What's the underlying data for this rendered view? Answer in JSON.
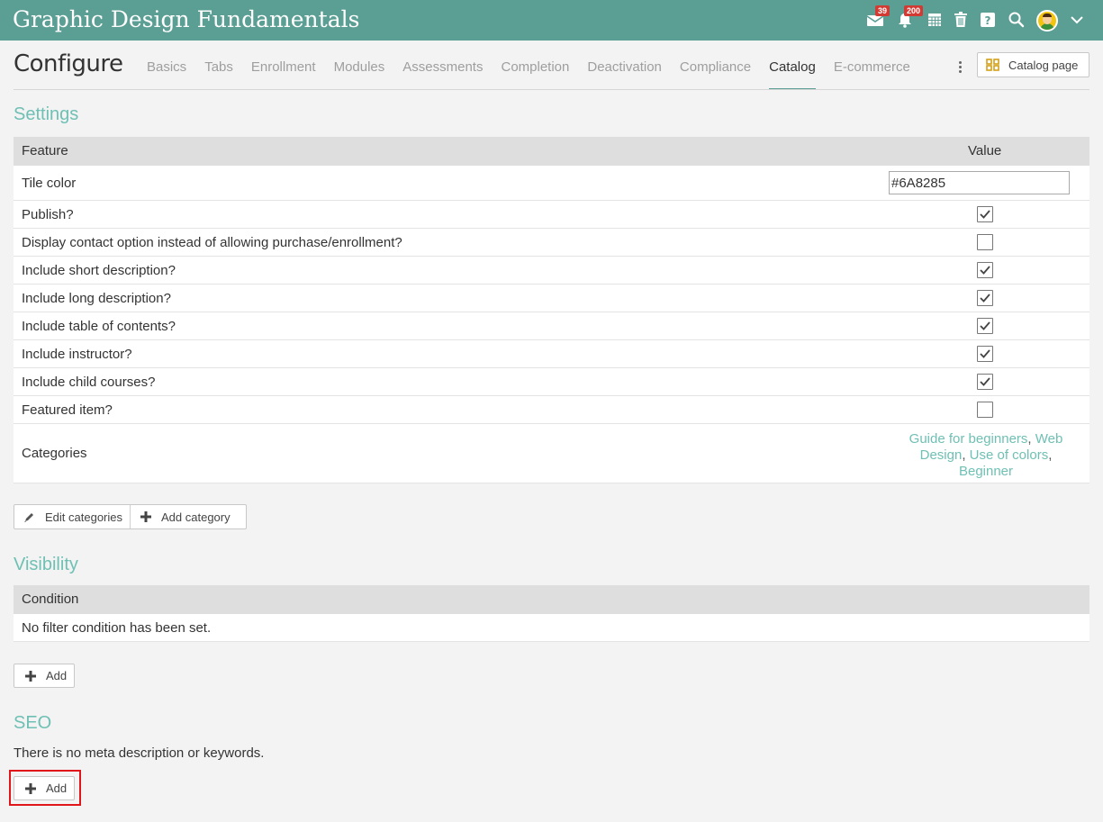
{
  "app": {
    "title": "Graphic Design Fundamentals"
  },
  "topbar": {
    "messages_badge": "39",
    "notifications_badge": "200",
    "icons": [
      "messages-icon",
      "notifications-icon",
      "calendar-icon",
      "trash-icon",
      "help-icon",
      "search-icon",
      "avatar",
      "chevron-down-icon"
    ]
  },
  "page": {
    "title": "Configure"
  },
  "tabs": [
    {
      "label": "Basics",
      "active": false
    },
    {
      "label": "Tabs",
      "active": false
    },
    {
      "label": "Enrollment",
      "active": false
    },
    {
      "label": "Modules",
      "active": false
    },
    {
      "label": "Assessments",
      "active": false
    },
    {
      "label": "Completion",
      "active": false
    },
    {
      "label": "Deactivation",
      "active": false
    },
    {
      "label": "Compliance",
      "active": false
    },
    {
      "label": "Catalog",
      "active": true
    },
    {
      "label": "E-commerce",
      "active": false
    }
  ],
  "catalog_page_button": {
    "label": "Catalog page"
  },
  "settings": {
    "title": "Settings",
    "header": {
      "feature": "Feature",
      "value": "Value"
    },
    "tile_color": {
      "label": "Tile color",
      "value": "#6A8285"
    },
    "rows": [
      {
        "label": "Publish?",
        "checked": true
      },
      {
        "label": "Display contact option instead of allowing purchase/enrollment?",
        "checked": false
      },
      {
        "label": "Include short description?",
        "checked": true
      },
      {
        "label": "Include long description?",
        "checked": true
      },
      {
        "label": "Include table of contents?",
        "checked": true
      },
      {
        "label": "Include instructor?",
        "checked": true
      },
      {
        "label": "Include child courses?",
        "checked": true
      },
      {
        "label": "Featured item?",
        "checked": false
      }
    ],
    "categories": {
      "label": "Categories",
      "items": [
        "Guide for beginners",
        "Web Design",
        "Use of colors",
        "Beginner"
      ]
    },
    "edit_categories": "Edit categories",
    "add_category": "Add category"
  },
  "visibility": {
    "title": "Visibility",
    "header": "Condition",
    "empty": "No filter condition has been set.",
    "add": "Add"
  },
  "seo": {
    "title": "SEO",
    "empty": "There is no meta description or keywords.",
    "add": "Add"
  },
  "colors": {
    "topbar": "#5a9e94",
    "accent": "#6fc0b4",
    "highlight": "#e0161b",
    "badge": "#d23b34"
  }
}
